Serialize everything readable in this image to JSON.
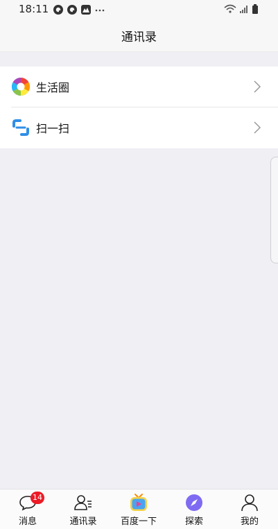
{
  "status_bar": {
    "time": "18:11",
    "notification_icons": [
      "qq-icon",
      "qq-icon",
      "mountain-app-icon",
      "more-dots-icon"
    ],
    "system_icons": [
      "wifi-icon",
      "signal-icon",
      "battery-icon"
    ]
  },
  "header": {
    "title": "通讯录"
  },
  "list": {
    "items": [
      {
        "label": "生活圈",
        "icon": "camera-aperture-icon"
      },
      {
        "label": "扫一扫",
        "icon": "scan-icon"
      }
    ]
  },
  "tab_bar": {
    "tabs": [
      {
        "label": "消息",
        "icon": "message-icon",
        "badge": "14"
      },
      {
        "label": "通讯录",
        "icon": "contacts-icon"
      },
      {
        "label": "百度一下",
        "icon": "tv-app-icon"
      },
      {
        "label": "探索",
        "icon": "compass-icon"
      },
      {
        "label": "我的",
        "icon": "person-icon"
      }
    ]
  },
  "colors": {
    "badge": "#ec1b26",
    "explore_icon": "#7f6bf2",
    "scan_icon": "#2f8ee6",
    "page_background": "#f0eff4"
  }
}
